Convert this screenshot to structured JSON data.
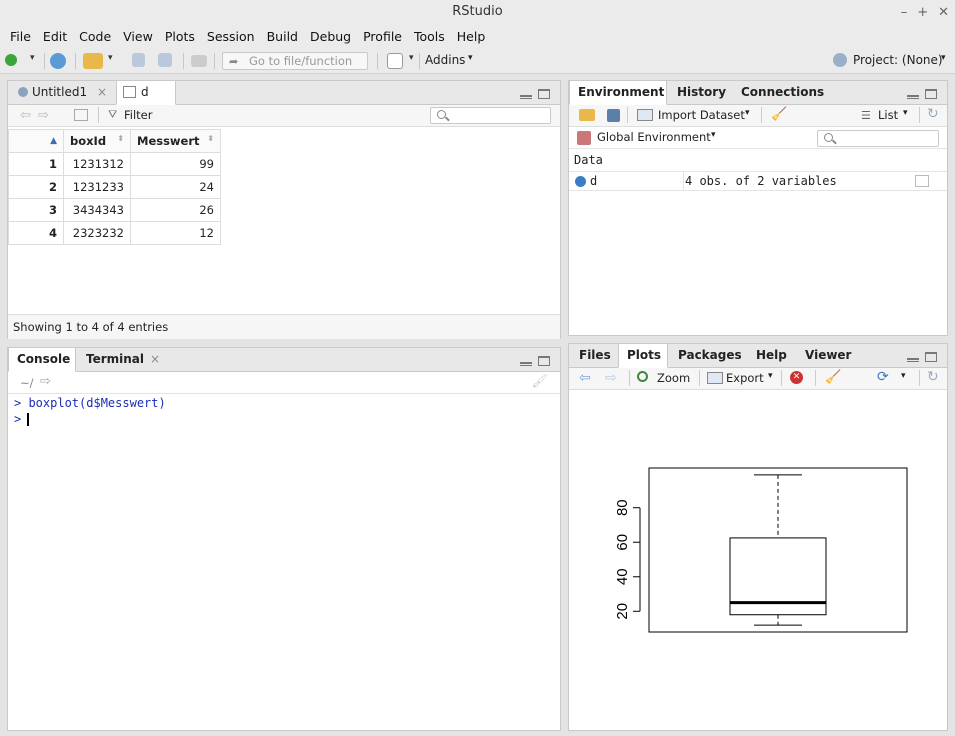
{
  "app": {
    "title": "RStudio"
  },
  "menu": [
    "File",
    "Edit",
    "Code",
    "View",
    "Plots",
    "Session",
    "Build",
    "Debug",
    "Profile",
    "Tools",
    "Help"
  ],
  "toolbar": {
    "goto_placeholder": "Go to file/function",
    "addins": "Addins",
    "project": "Project: (None)"
  },
  "source": {
    "tabs": [
      {
        "label": "Untitled1"
      },
      {
        "label": "d"
      }
    ],
    "filter": "Filter",
    "columns": [
      "boxId",
      "Messwert"
    ],
    "rows": [
      {
        "n": "1",
        "boxId": "1231312",
        "Messwert": "99"
      },
      {
        "n": "2",
        "boxId": "1231233",
        "Messwert": "24"
      },
      {
        "n": "3",
        "boxId": "3434343",
        "Messwert": "26"
      },
      {
        "n": "4",
        "boxId": "2323232",
        "Messwert": "12"
      }
    ],
    "footer": "Showing 1 to 4 of 4 entries"
  },
  "console": {
    "tabs": [
      "Console",
      "Terminal"
    ],
    "path": "~/",
    "lines": [
      "> boxplot(d$Messwert)",
      ">"
    ]
  },
  "environment": {
    "tabs": [
      "Environment",
      "History",
      "Connections"
    ],
    "import": "Import Dataset",
    "view": "List",
    "scope": "Global Environment",
    "section": "Data",
    "var_name": "d",
    "var_value": "4 obs. of 2 variables"
  },
  "files": {
    "tabs": [
      "Files",
      "Plots",
      "Packages",
      "Help",
      "Viewer"
    ],
    "zoom": "Zoom",
    "export": "Export"
  },
  "chart_data": {
    "type": "boxplot",
    "title": "",
    "xlabel": "",
    "ylabel": "",
    "yticks": [
      "20",
      "40",
      "60",
      "80"
    ],
    "ylim": [
      8,
      103
    ],
    "stats": {
      "min": 12,
      "q1": 18,
      "median": 25,
      "q3": 62.5,
      "max": 99
    }
  }
}
